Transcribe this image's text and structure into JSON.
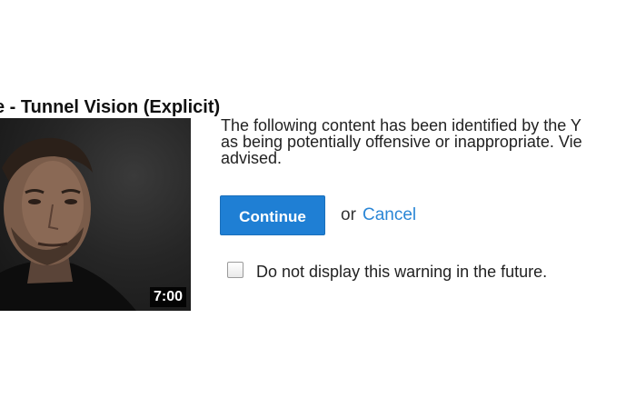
{
  "video": {
    "title": "e - Tunnel Vision (Explicit)",
    "duration": "7:00"
  },
  "warning": {
    "message": "The following content has been identified by the Y\nas being potentially offensive or inappropriate. Vie\nadvised.",
    "continue_label": "Continue",
    "or_text": "or",
    "cancel_label": "Cancel",
    "checkbox_label": "Do not display this warning in the future.",
    "checkbox_checked": false
  },
  "colors": {
    "button": "#1f7fd4",
    "link": "#2a86d6"
  }
}
